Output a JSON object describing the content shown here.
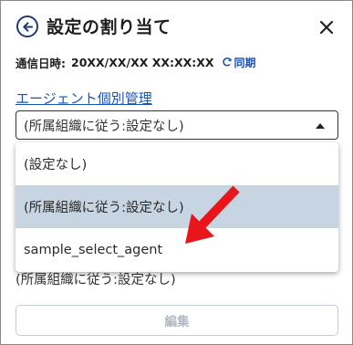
{
  "header": {
    "title": "設定の割り当て",
    "back_icon": "arrow-left-circle-icon",
    "close_icon": "close-icon"
  },
  "datetime": {
    "label": "通信日時:",
    "value": "20XX/XX/XX XX:XX:XX",
    "sync_label": "同期",
    "sync_icon": "refresh-icon"
  },
  "agent_section": {
    "link_label": "エージェント個別管理",
    "select": {
      "selected": "(所属組織に従う:設定なし)",
      "options": [
        "(設定なし)",
        "(所属組織に従う:設定なし)",
        "sample_select_agent"
      ],
      "highlighted_index": 1
    },
    "current_value": "(所属組織に従う:設定なし)"
  },
  "edit_button": {
    "label": "編集"
  },
  "colors": {
    "link": "#1a54b8",
    "highlight": "#c7d4e2",
    "annotation_arrow": "#e8151b"
  }
}
